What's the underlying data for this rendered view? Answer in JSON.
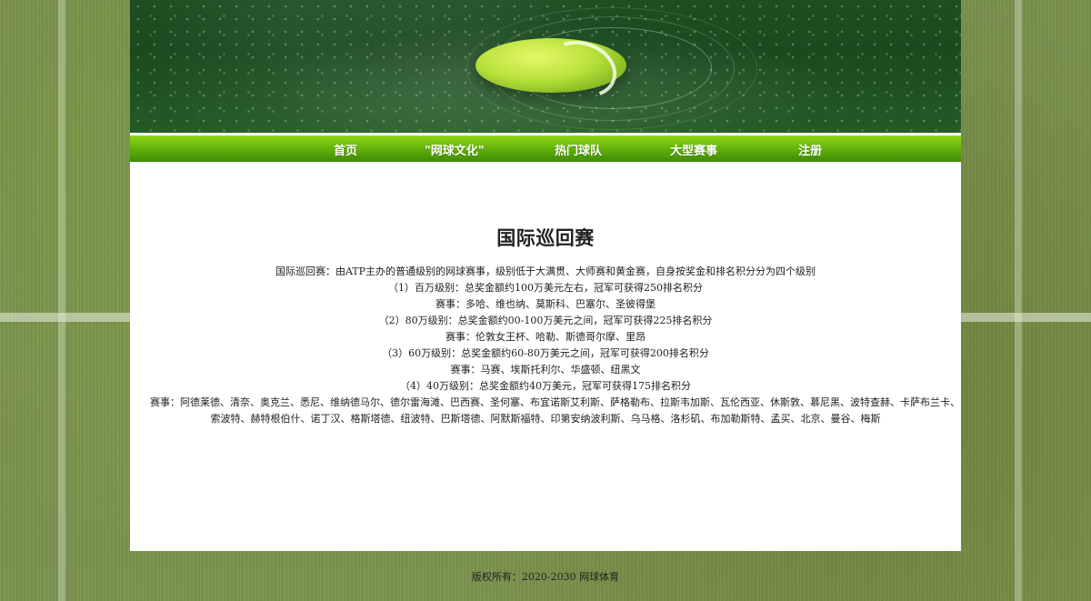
{
  "nav": {
    "items": [
      {
        "label": "首页"
      },
      {
        "label": "\"网球文化\""
      },
      {
        "label": "热门球队"
      },
      {
        "label": "大型赛事"
      },
      {
        "label": "注册"
      }
    ]
  },
  "main": {
    "title": "国际巡回赛",
    "lines": [
      "国际巡回赛：由ATP主办的普通级别的网球赛事，级别低于大满贯、大师赛和黄金赛，自身按奖金和排名积分分为四个级别",
      "（1）百万级别：总奖金额约100万美元左右，冠军可获得250排名积分",
      "赛事：多哈、维也纳、莫斯科、巴塞尔、圣彼得堡",
      "（2）80万级别：总奖金额约00-100万美元之间，冠军可获得225排名积分",
      "赛事：伦敦女王杯、哈勒、斯德哥尔摩、里昂",
      "（3）60万级别：总奖金额约60-80万美元之间，冠军可获得200排名积分",
      "赛事：马赛、埃斯托利尔、华盛顿、纽黑文",
      "（4）40万级别：总奖金额约40万美元，冠军可获得175排名积分",
      "赛事：阿德莱德、清奈、奥克兰、悉尼、维纳德马尔、德尔雷海滩、巴西赛、圣何塞、布宜诺斯艾利斯、萨格勒布、拉斯韦加斯、瓦伦西亚、休斯敦、慕尼黑、波特查赫、卡萨布兰卡、",
      "索波特、赫特根伯什、诺丁汉、格斯塔德、纽波特、巴斯塔德、阿默斯福特、印第安纳波利斯、乌马格、洛杉矶、布加勒斯特、孟买、北京、曼谷、梅斯"
    ]
  },
  "footer": {
    "text": "版权所有：2020-2030 网球体育"
  }
}
